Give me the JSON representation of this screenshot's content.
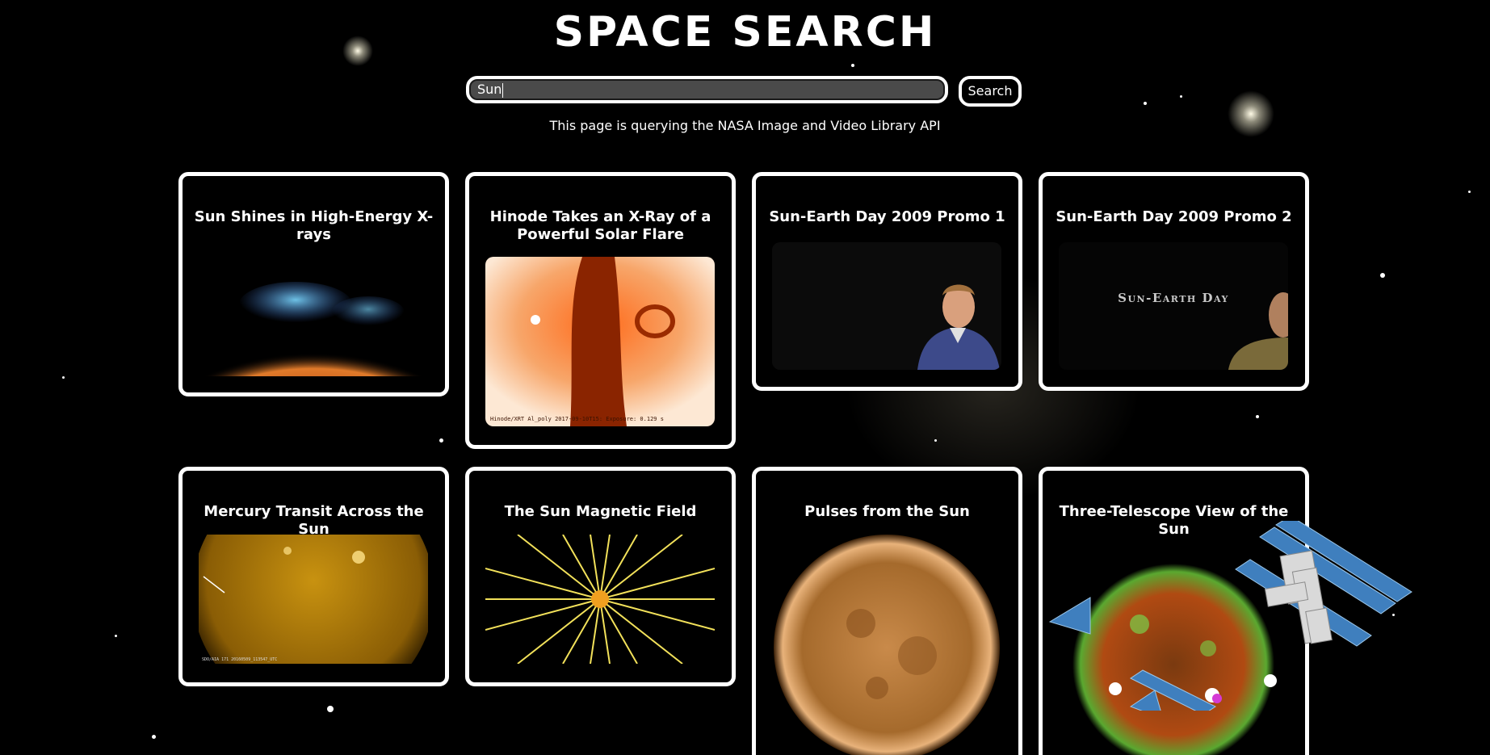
{
  "header": {
    "title": "SPACE SEARCH"
  },
  "search": {
    "value": "Sun",
    "button_label": "Search",
    "note": "This page is querying the NASA Image and Video Library API"
  },
  "results": [
    {
      "title": "Sun Shines in High-Energy X-rays",
      "image": "sun-xray-limb-image"
    },
    {
      "title": "Hinode Takes an X-Ray of a Powerful Solar Flare",
      "image": "hinode-solar-flare-image",
      "caption": "Hinode/XRT Al_poly 2017-09-10T15:     Exposure: 0.129 s"
    },
    {
      "title": "Sun-Earth Day 2009 Promo 1",
      "image": "presenter-video-still"
    },
    {
      "title": "Sun-Earth Day 2009 Promo 2",
      "image": "sun-earth-day-title-still",
      "overlay_text": "Sun-Earth Day"
    },
    {
      "title": "Mercury Transit Across the Sun",
      "image": "mercury-transit-image",
      "caption": "SDO/AIA 171 20160509_113547_UTC"
    },
    {
      "title": "The Sun Magnetic Field",
      "image": "magnetic-field-diagram"
    },
    {
      "title": "Pulses from the Sun",
      "image": "sun-pulses-image"
    },
    {
      "title": "Three-Telescope View of the Sun",
      "image": "three-telescope-sun-image"
    }
  ],
  "colors": {
    "background": "#000000",
    "card_border": "#ffffff",
    "input_bg": "#4a4a4a"
  }
}
